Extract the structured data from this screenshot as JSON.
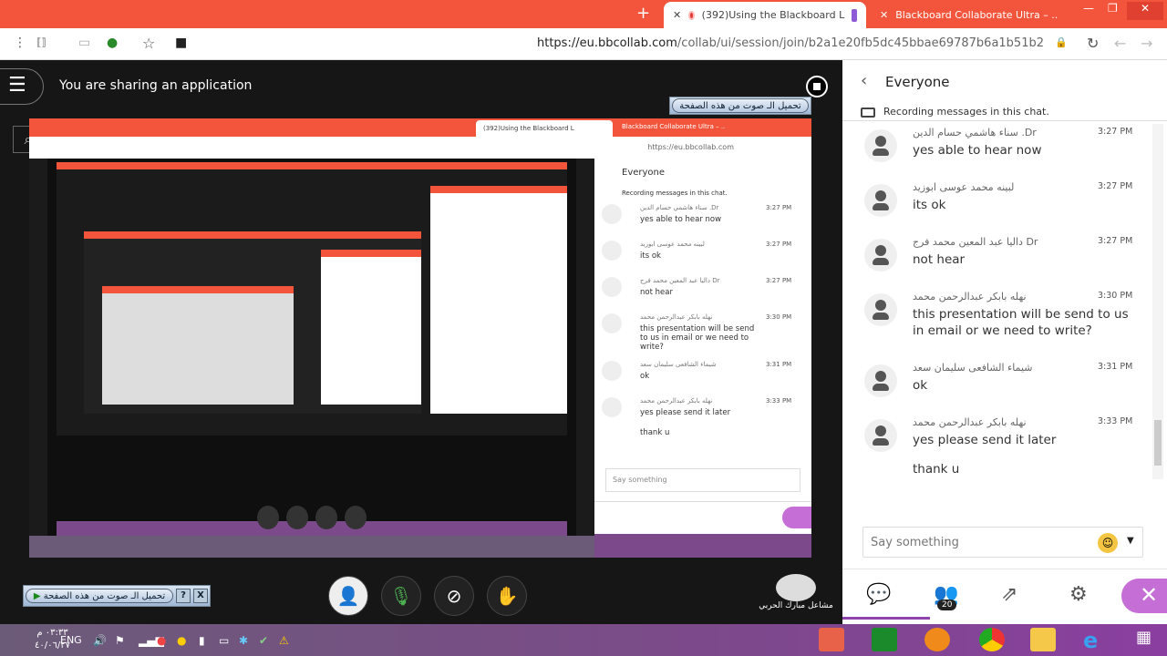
{
  "browser": {
    "tabs": [
      {
        "label": "(392)Using the Blackboard L",
        "active": true
      },
      {
        "label": "Blackboard Collaborate Ultra – ..",
        "active": false
      }
    ],
    "url_host": "https://eu.bbcollab.com",
    "url_path": "/collab/ui/session/join/b2a1e20fb5dc45bbae69787b6a1b51b2"
  },
  "share": {
    "banner": "You are sharing an application"
  },
  "toolbar_ar": {
    "label": "تحميل الـ صوت من هذه الصفحة",
    "help": "?",
    "close": "X"
  },
  "chat": {
    "title": "Everyone",
    "recording": "Recording messages in this chat.",
    "messages": [
      {
        "name": "سناء هاشمي حسام الدين .Dr",
        "time": "3:27 PM",
        "text": "yes able to hear now"
      },
      {
        "name": "لبينه محمد عوسى ابوزيد",
        "time": "3:27 PM",
        "text": "its ok"
      },
      {
        "name": "داليا عبد المعين محمد فرج Dr",
        "time": "3:27 PM",
        "text": "not hear"
      },
      {
        "name": "نهله بابكر عبدالرحمن محمد",
        "time": "3:30 PM",
        "text": "this presentation will be send to us in email or we need to write?"
      },
      {
        "name": "شيماء الشافعى سليمان سعد",
        "time": "3:31 PM",
        "text": "ok"
      },
      {
        "name": "نهله بابكر عبدالرحمن محمد",
        "time": "3:33 PM",
        "text": "yes please send it later",
        "text2": "thank u"
      }
    ],
    "input_placeholder": "Say something",
    "participants_count": "20"
  },
  "presenter": {
    "name": "مشاعل مبارك الحربي"
  },
  "taskbar": {
    "time": "٠٣:٣٣ م",
    "date": "٤٠/٠٦/٢٧",
    "lang": "ENG"
  },
  "colors": {
    "chrome": "#f2553c",
    "accent": "#c46ed6",
    "taskbar": "#7c4a8a"
  }
}
